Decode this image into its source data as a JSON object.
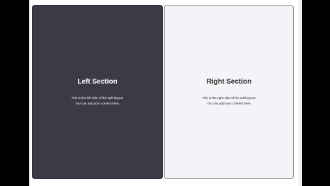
{
  "left_section": {
    "title": "Left Section",
    "line1": "This is the left side of the split layout.",
    "line2": "You can add your content here."
  },
  "right_section": {
    "title": "Right Section",
    "line1": "This is the right side of the split layout.",
    "line2": "You can add your content here."
  },
  "colors": {
    "left_background": "#3b3a45",
    "right_background": "#f3f4f7",
    "page_background": "#ffffff",
    "outer_background": "#000000"
  }
}
